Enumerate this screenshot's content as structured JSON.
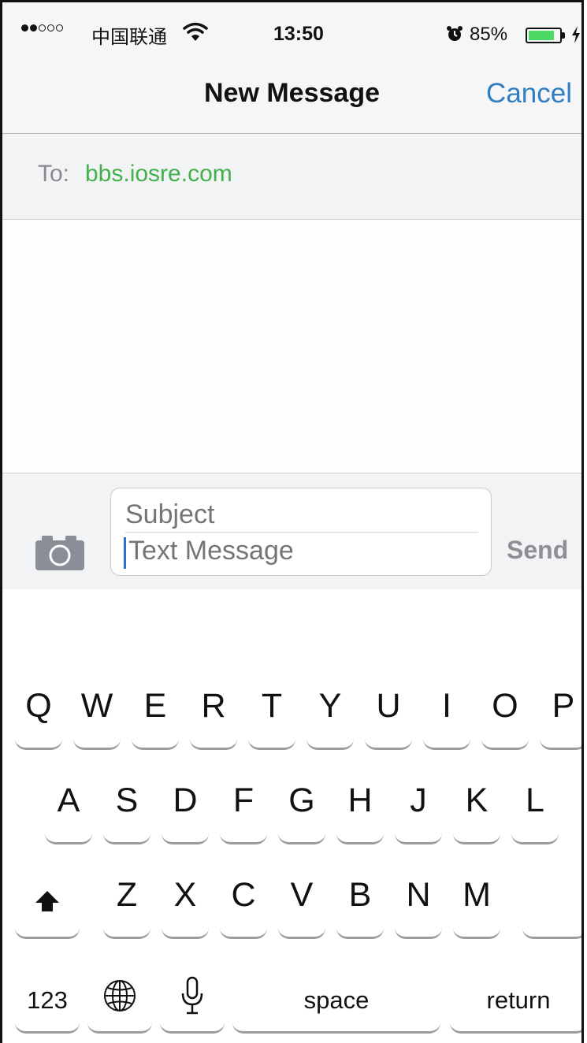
{
  "status_bar": {
    "carrier": "中国联通",
    "time": "13:50",
    "battery_percent": "85%",
    "battery_level": 0.85,
    "signal_bars_filled": 2,
    "signal_bars_total": 5
  },
  "nav": {
    "title": "New Message",
    "cancel_label": "Cancel"
  },
  "recipient": {
    "label": "To:",
    "value": "bbs.iosre.com"
  },
  "compose": {
    "subject_placeholder": "Subject",
    "message_placeholder": "Text Message",
    "send_label": "Send"
  },
  "keyboard": {
    "row1": [
      "Q",
      "W",
      "E",
      "R",
      "T",
      "Y",
      "U",
      "I",
      "O",
      "P"
    ],
    "row2": [
      "A",
      "S",
      "D",
      "F",
      "G",
      "H",
      "J",
      "K",
      "L"
    ],
    "row3": [
      "Z",
      "X",
      "C",
      "V",
      "B",
      "N",
      "M"
    ],
    "numbers_label": "123",
    "space_label": "space",
    "return_label": "return",
    "icons": [
      "shift-icon",
      "globe-icon",
      "microphone-icon",
      "delete-icon"
    ]
  },
  "colors": {
    "accent_blue": "#2f7ec4",
    "recipient_green": "#43b04a",
    "battery_green": "#4cd964"
  }
}
